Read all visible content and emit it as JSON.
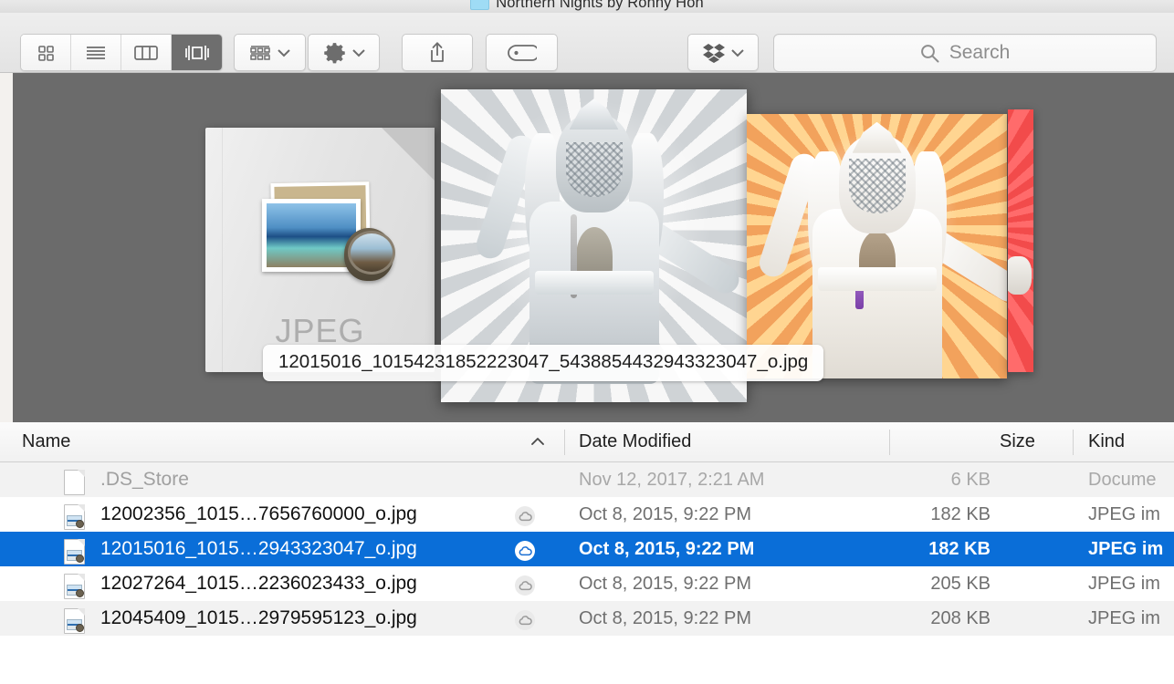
{
  "window": {
    "title": "Northern Nights by Ronny Hon",
    "folder_icon": "folder-icon"
  },
  "toolbar": {
    "view_buttons": [
      {
        "name": "icon-view",
        "label": "Icon View"
      },
      {
        "name": "list-view",
        "label": "List View"
      },
      {
        "name": "column-view",
        "label": "Column View"
      },
      {
        "name": "coverflow-view",
        "label": "Cover Flow View",
        "selected": true
      }
    ],
    "arrange_label": "Arrange",
    "action_label": "Action",
    "share_label": "Share",
    "tags_label": "Tags",
    "dropbox_label": "Dropbox",
    "search": {
      "placeholder": "Search",
      "value": ""
    }
  },
  "coverflow": {
    "selected_filename": "12015016_10154231852223047_5438854432943323047_o.jpg",
    "doc_icon_type": "JPEG",
    "background_color": "#6b6b6b"
  },
  "columns": [
    {
      "key": "name",
      "label": "Name",
      "sorted": "ascending"
    },
    {
      "key": "date",
      "label": "Date Modified"
    },
    {
      "key": "size",
      "label": "Size"
    },
    {
      "key": "kind",
      "label": "Kind"
    }
  ],
  "files": [
    {
      "name": ".DS_Store",
      "date": "Nov 12, 2017, 2:21 AM",
      "size": "6 KB",
      "kind": "Docume",
      "icon": "blank-document-icon",
      "cloud": false,
      "selected": false,
      "dimmed": true
    },
    {
      "name": "12002356_1015…7656760000_o.jpg",
      "date": "Oct 8, 2015, 9:22 PM",
      "size": "182 KB",
      "kind": "JPEG im",
      "icon": "jpeg-document-icon",
      "cloud": true,
      "selected": false,
      "dimmed": false
    },
    {
      "name": "12015016_1015…2943323047_o.jpg",
      "date": "Oct 8, 2015, 9:22 PM",
      "size": "182 KB",
      "kind": "JPEG im",
      "icon": "jpeg-document-icon",
      "cloud": true,
      "selected": true,
      "dimmed": false
    },
    {
      "name": "12027264_1015…2236023433_o.jpg",
      "date": "Oct 8, 2015, 9:22 PM",
      "size": "205 KB",
      "kind": "JPEG im",
      "icon": "jpeg-document-icon",
      "cloud": true,
      "selected": false,
      "dimmed": false
    },
    {
      "name": "12045409_1015…2979595123_o.jpg",
      "date": "Oct 8, 2015, 9:22 PM",
      "size": "208 KB",
      "kind": "JPEG im",
      "icon": "jpeg-document-icon",
      "cloud": true,
      "selected": false,
      "dimmed": false
    }
  ],
  "colors": {
    "selection_blue": "#0a6ed8",
    "coverflow_grey": "#6b6b6b",
    "toolbar_grey": "#e8e8e8"
  }
}
